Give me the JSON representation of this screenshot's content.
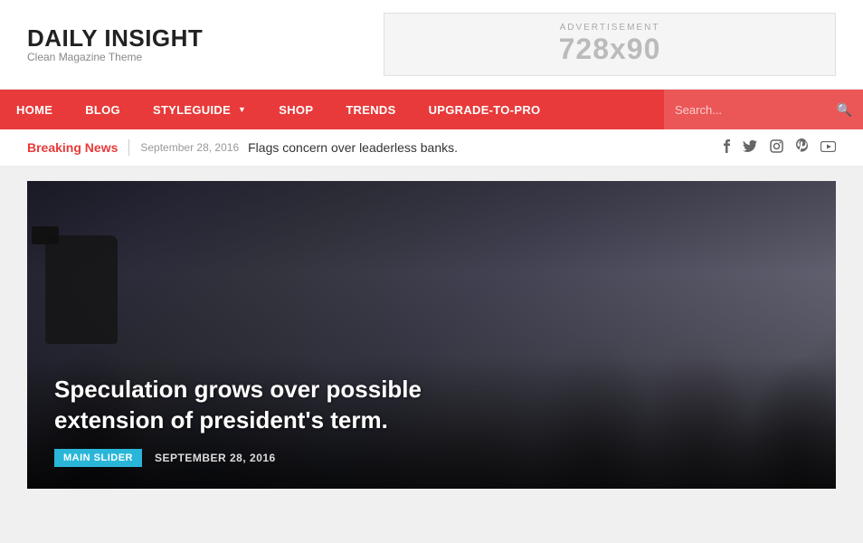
{
  "header": {
    "logo_title": "DAILY INSIGHT",
    "logo_subtitle": "Clean Magazine Theme",
    "ad_label": "ADVERTISEMENT",
    "ad_size": "728x90"
  },
  "nav": {
    "items": [
      {
        "label": "HOME",
        "has_dropdown": false
      },
      {
        "label": "BLOG",
        "has_dropdown": false
      },
      {
        "label": "STYLEGUIDE",
        "has_dropdown": true
      },
      {
        "label": "SHOP",
        "has_dropdown": false
      },
      {
        "label": "TRENDS",
        "has_dropdown": false
      },
      {
        "label": "UPGRADE-TO-PRO",
        "has_dropdown": false
      }
    ],
    "search_placeholder": "Search..."
  },
  "breaking_news": {
    "label": "Breaking News",
    "divider": "|",
    "date": "September 28, 2016",
    "text": "Flags concern over leaderless banks."
  },
  "social": {
    "icons": [
      "f",
      "t",
      "ig",
      "p",
      "yt"
    ]
  },
  "hero": {
    "title": "Speculation grows over possible extension of president's term.",
    "category_badge": "MAIN SLIDER",
    "date": "SEPTEMBER 28, 2016"
  }
}
